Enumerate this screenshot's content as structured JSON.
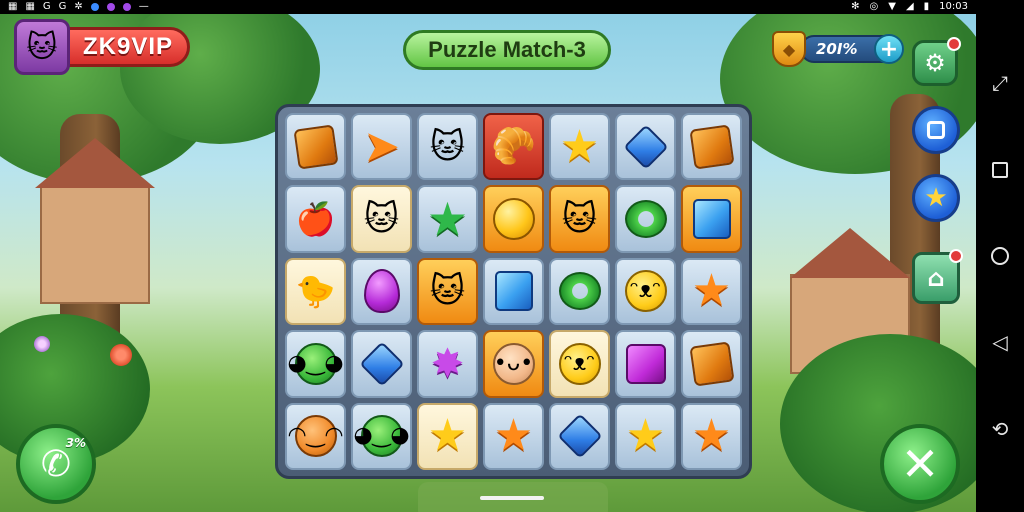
{
  "status_bar": {
    "left_icons": [
      "grid-icon",
      "grid-icon",
      "g-icon",
      "g-icon",
      "settings-icon",
      "blue-dot-icon",
      "purple-dot-icon",
      "purple-dot-icon",
      "minus-icon"
    ],
    "right_icons": [
      "nfc-icon",
      "alarm-icon",
      "wifi-icon",
      "signal-icon",
      "battery-icon"
    ],
    "time": "10:03"
  },
  "header": {
    "vip_label": "ZK9VIP",
    "title": "Puzzle Match-3",
    "score": "20I%",
    "plus_label": "+"
  },
  "right_buttons": {
    "settings_icon": "gear-icon",
    "square_icon": "square-icon",
    "star_icon": "star-icon",
    "home_icon": "home-icon"
  },
  "bottom": {
    "call_badge": "3%",
    "call_icon": "phone-icon",
    "close_icon": "close-icon"
  },
  "board": {
    "rows": [
      [
        "cube-orange",
        "fish-orange",
        "cat-orange",
        "bread-red",
        "star-yellow",
        "gem-blue",
        "cube-orange"
      ],
      [
        "apple-red",
        "cat-orange",
        "star-green",
        "orb-yellow",
        "cat-orange",
        "ring-green",
        "cube-blue"
      ],
      [
        "bird-yellow",
        "drop-purple",
        "cat-orange",
        "cube-blue",
        "ring-green",
        "face-yellow",
        "star-orange"
      ],
      [
        "face-green",
        "diamond-blue",
        "star-purple",
        "face-skin",
        "face-yellow",
        "cube-purple",
        "cube-orange"
      ],
      [
        "face-orange",
        "face-green",
        "star-yellow",
        "star-orange",
        "diamond-blue",
        "star-yellow",
        "star-orange"
      ]
    ]
  },
  "colors": {
    "accent_green": "#62c544",
    "vip_red": "#d72f2b",
    "board_bg": "#4b5d75"
  }
}
